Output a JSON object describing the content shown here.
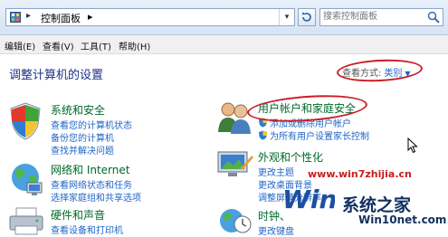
{
  "address_bar": {
    "separator": "▸",
    "path": "控制面板",
    "path_separator": "▸",
    "dropdown_glyph": "▾",
    "search_placeholder": "搜索控制面板",
    "icons": [
      "control-panel-icon",
      "refresh-icon",
      "search-icon"
    ]
  },
  "menu": {
    "items": [
      "编辑(E)",
      "查看(V)",
      "工具(T)",
      "帮助(H)"
    ]
  },
  "content": {
    "heading": "调整计算机的设置",
    "view_by_label": "查看方式:",
    "view_by_value": "类别",
    "view_by_arrow": "▼"
  },
  "categories": {
    "system": {
      "title": "系统和安全",
      "links": [
        "查看您的计算机状态",
        "备份您的计算机",
        "查找并解决问题"
      ],
      "icon": "shield-icon"
    },
    "network": {
      "title": "网络和 Internet",
      "links": [
        "查看网络状态和任务",
        "选择家庭组和共享选项"
      ],
      "icon": "network-globe-icon"
    },
    "hardware": {
      "title": "硬件和声音",
      "links": [
        "查看设备和打印机"
      ],
      "icon": "printer-icon"
    },
    "user_accounts": {
      "title": "用户帐户和家庭安全",
      "links": [
        "添加或删除用户帐户",
        "为所有用户设置家长控制"
      ],
      "icon": "users-icon"
    },
    "appearance": {
      "title": "外观和个性化",
      "links": [
        "更改主题",
        "更改桌面背景",
        "调整屏幕分辨率"
      ],
      "icon": "appearance-icon"
    },
    "clock": {
      "title": "时钟、",
      "links": [
        "更改键盘"
      ],
      "icon": "clock-globe-icon"
    }
  },
  "watermark": {
    "url": "www.win7zhijia.cn",
    "brand": "系统之家",
    "domain": "Win10net.com"
  },
  "colors": {
    "category_title": "#00692c",
    "link": "#1e64c8",
    "heading": "#1e3287",
    "annotation_circle": "#c81e28"
  }
}
